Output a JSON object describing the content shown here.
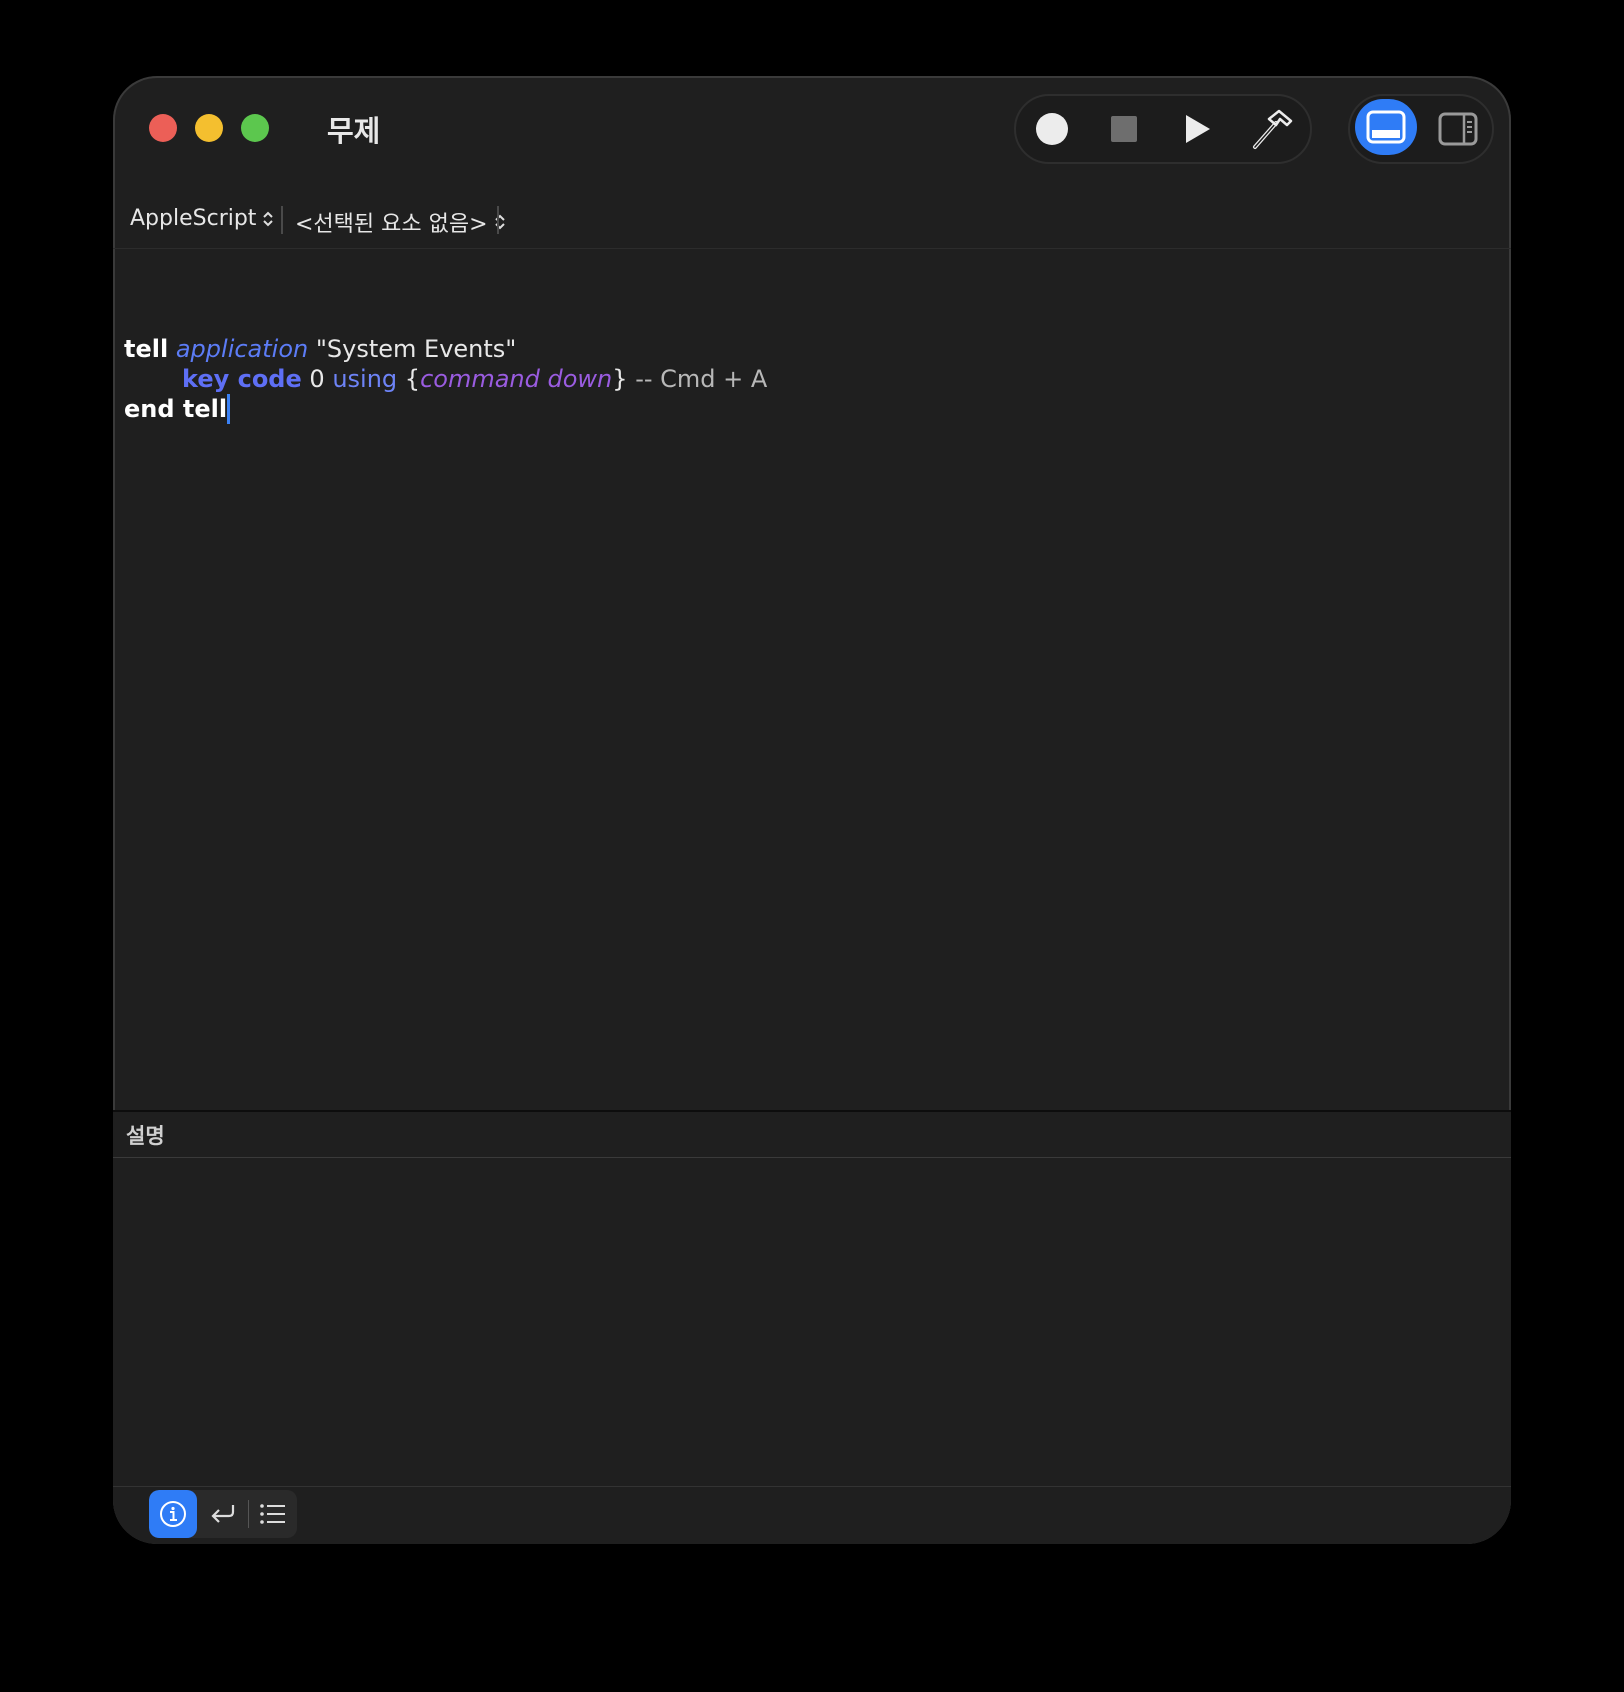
{
  "window": {
    "title": "무제"
  },
  "toolbar": {
    "record": "record-icon",
    "stop": "stop-icon",
    "run": "play-icon",
    "compile": "hammer-icon",
    "view_bottom": "bottom-panel-icon",
    "view_side": "side-panel-icon",
    "active_view": "bottom-panel"
  },
  "navbar": {
    "language": "AppleScript",
    "element": "<선택된 요소 없음>"
  },
  "code": {
    "line1": {
      "kw": "tell",
      "app": "application",
      "str": "\"System Events\""
    },
    "line2": {
      "cmd": "key code",
      "num": "0",
      "using": "using",
      "open": "{",
      "prop": "command down",
      "close": "}",
      "comment": "-- Cmd + A"
    },
    "line3": {
      "kw": "end tell"
    }
  },
  "description": {
    "title": "설명"
  },
  "bottom_tabs": {
    "items": [
      "info-icon",
      "return-icon",
      "list-icon"
    ],
    "active": "info-icon"
  },
  "colors": {
    "accent": "#2f7cf6",
    "keyword": "#ffffff",
    "application": "#5c7cf6",
    "command": "#5e6ff5",
    "property": "#9a5ce0",
    "comment": "#b8b8b8"
  }
}
